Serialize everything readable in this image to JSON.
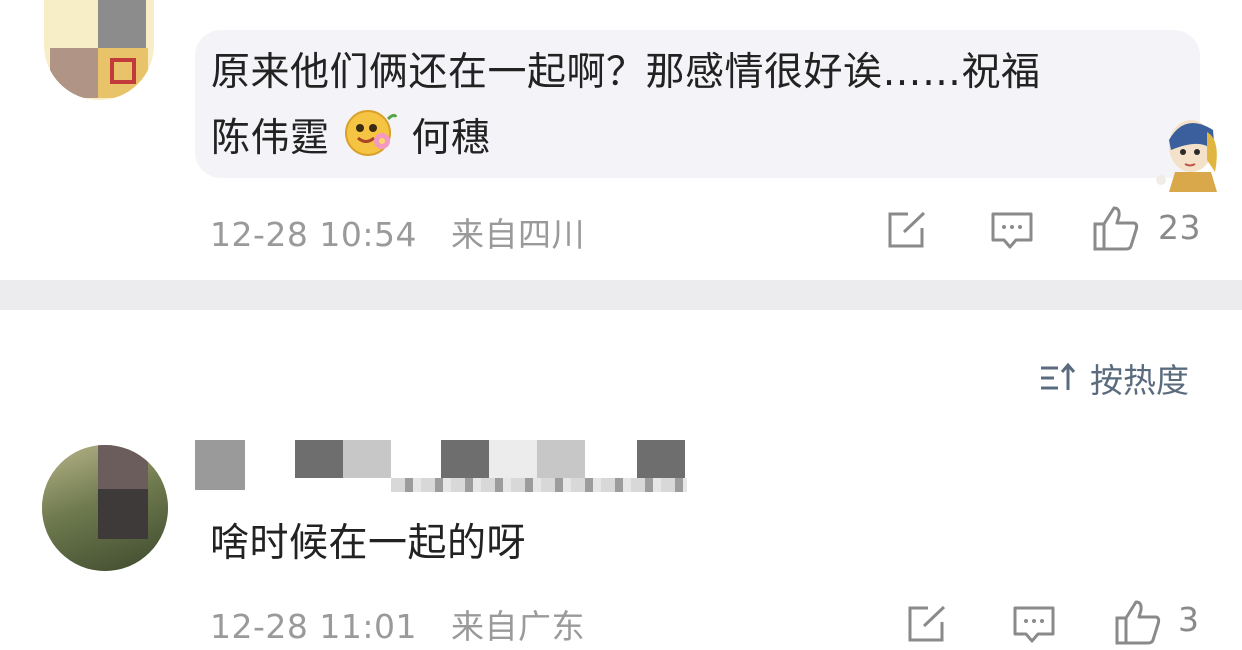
{
  "comments": [
    {
      "text_line1": "原来他们俩还在一起啊？那感情很好诶……祝福",
      "text_line2_part1": "陈伟霆",
      "text_line2_part2": "何穗",
      "timestamp": "12-28 10:54",
      "location": "来自四川",
      "likes": "23"
    },
    {
      "text": "啥时候在一起的呀",
      "timestamp": "12-28 11:01",
      "location": "来自广东",
      "likes": "3"
    }
  ],
  "sort": {
    "label": "按热度"
  },
  "icons": {
    "share": "share-icon",
    "reply": "comment-icon",
    "like": "thumbs-up-icon",
    "sort": "sort-icon",
    "emoji": "flower-emoji-icon",
    "sticker": "girl-sticker-icon"
  },
  "colors": {
    "meta": "#9a9a9a",
    "sort": "#5b6b7e",
    "bubble": "#f4f4f8",
    "separator": "#ececef"
  }
}
